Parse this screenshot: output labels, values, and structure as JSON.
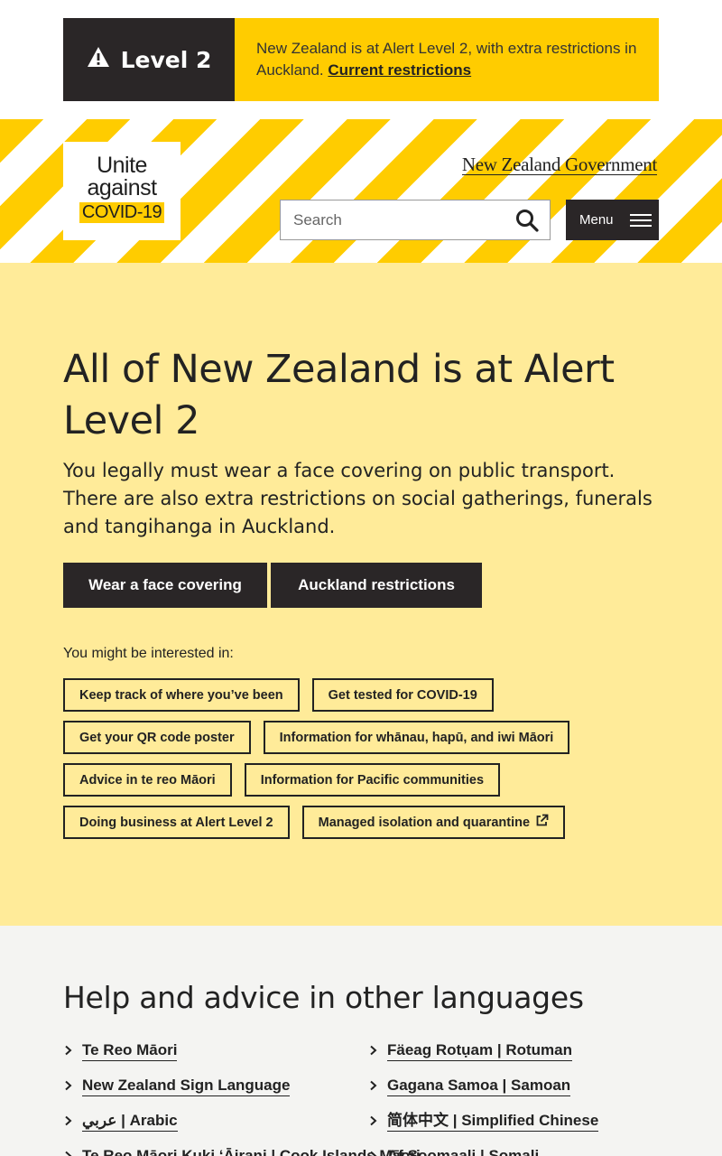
{
  "alert": {
    "level": "Level 2",
    "message": "New Zealand is at Alert Level 2, with extra restrictions in Auckland.",
    "link": "Current restrictions",
    "colors": {
      "dark": "#2a2627",
      "yellow": "#ffcc00"
    }
  },
  "header": {
    "logo": {
      "line1": "Unite",
      "line2": "against",
      "line3": "COVID-19"
    },
    "govt": "New Zealand Government",
    "search_placeholder": "Search",
    "menu_label": "Menu"
  },
  "hero": {
    "title": "All of New Zealand is at Alert Level 2",
    "lede": "You legally must wear a face covering on public transport. There are also extra restrictions on social gatherings, funerals and tangihanga in Auckland.",
    "cta1": "Wear a face covering",
    "cta2": "Auckland restrictions",
    "interest_label": "You might be interested in:",
    "chips": [
      "Keep track of where you’ve been",
      "Get tested for COVID-19",
      "Get your QR code poster",
      "Information for whānau, hapū, and iwi Māori",
      "Advice in te reo Māori",
      "Information for Pacific communities",
      "Doing business at Alert Level 2",
      "Managed isolation and quarantine"
    ],
    "background": "#ffeb99"
  },
  "languages": {
    "heading": "Help and advice in other languages",
    "items": [
      "Te Reo Māori",
      "Fäeag Rotụam | Rotuman",
      "New Zealand Sign Language",
      "Gagana Samoa | Samoan",
      "عربي | Arabic",
      "简体中文 | Simplified Chinese",
      "Te Reo Māori Kuki ‘Āirani | Cook Islands Māori",
      "Af Soomaali | Somali"
    ]
  },
  "icons": {
    "warning": "warning-icon",
    "search": "search-icon",
    "menu": "hamburger-icon",
    "external": "external-link-icon",
    "chevron": "chevron-right-icon"
  }
}
